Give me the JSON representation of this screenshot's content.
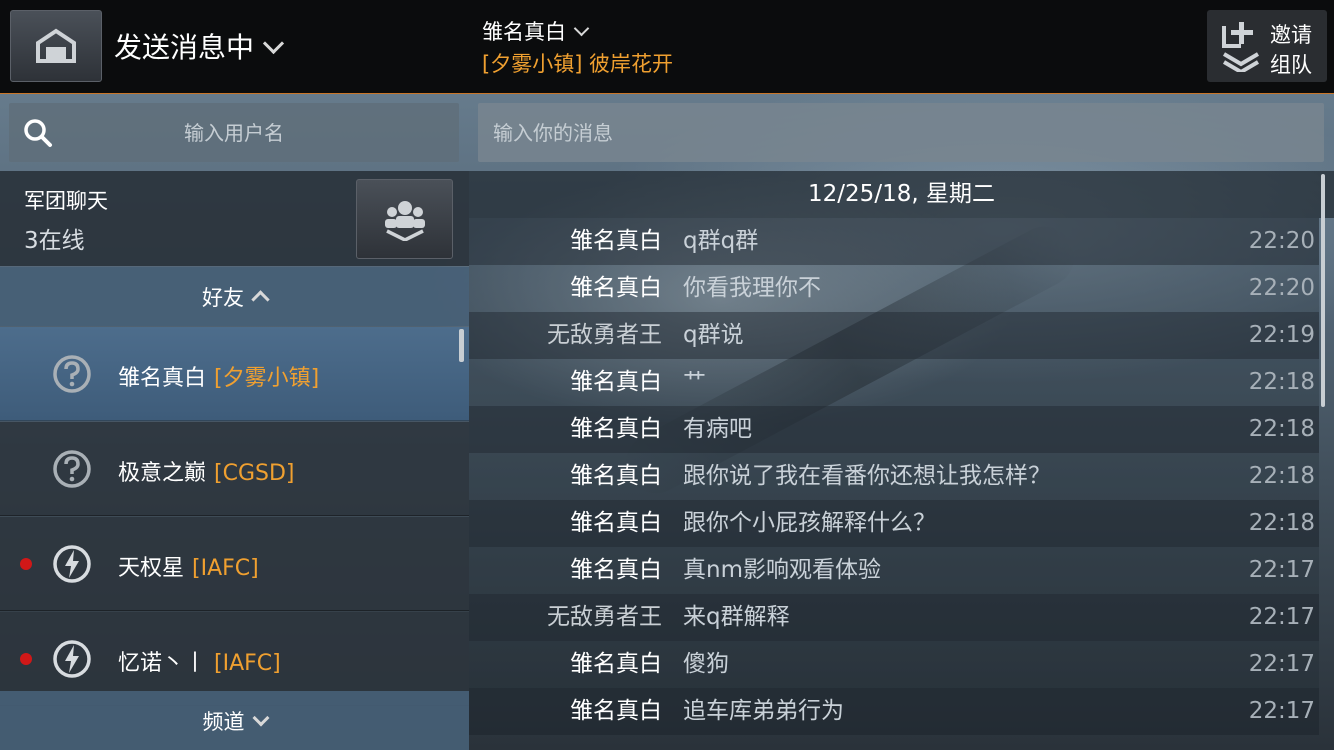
{
  "header": {
    "status_title": "发送消息中",
    "chat_target": "雏名真白",
    "chat_subtitle": "[夕雾小镇] 彼岸花开",
    "invite_line1": "邀请",
    "invite_line2": "组队"
  },
  "search": {
    "placeholder": "输入用户名"
  },
  "message_input": {
    "placeholder": "输入你的消息"
  },
  "clan": {
    "name": "军团聊天",
    "online": "3在线"
  },
  "sections": {
    "friends": "好友",
    "channels": "频道"
  },
  "friends": [
    {
      "name": "雏名真白",
      "clan": "[夕雾小镇]",
      "icon": "question-icon",
      "online_dot": false,
      "selected": true
    },
    {
      "name": "极意之巅",
      "clan": "[CGSD]",
      "icon": "question-icon",
      "online_dot": false,
      "selected": false
    },
    {
      "name": "天权星",
      "clan": "[IAFC]",
      "icon": "lightning-icon",
      "online_dot": true,
      "selected": false
    },
    {
      "name": "忆诺丶丨",
      "clan": "[IAFC]",
      "icon": "lightning-icon",
      "online_dot": true,
      "selected": false
    }
  ],
  "chat": {
    "date": "12/25/18, 星期二",
    "messages": [
      {
        "sender": "雏名真白",
        "text": "q群q群",
        "time": "22:20"
      },
      {
        "sender": "雏名真白",
        "text": "你看我理你不",
        "time": "22:20"
      },
      {
        "sender": "无敌勇者王",
        "text": "q群说",
        "time": "22:19"
      },
      {
        "sender": "雏名真白",
        "text": "艹",
        "time": "22:18"
      },
      {
        "sender": "雏名真白",
        "text": "有病吧",
        "time": "22:18"
      },
      {
        "sender": "雏名真白",
        "text": "跟你说了我在看番你还想让我怎样？",
        "time": "22:18"
      },
      {
        "sender": "雏名真白",
        "text": "跟你个小屁孩解释什么？",
        "time": "22:18"
      },
      {
        "sender": "雏名真白",
        "text": "真nm影响观看体验",
        "time": "22:17"
      },
      {
        "sender": "无敌勇者王",
        "text": "来q群解释",
        "time": "22:17"
      },
      {
        "sender": "雏名真白",
        "text": "傻狗",
        "time": "22:17"
      },
      {
        "sender": "雏名真白",
        "text": "追车库弟弟行为",
        "time": "22:17"
      }
    ]
  },
  "colors": {
    "accent_orange": "#f0a030",
    "online_dot": "#d01818",
    "selected_row": "#4d6d8c"
  }
}
